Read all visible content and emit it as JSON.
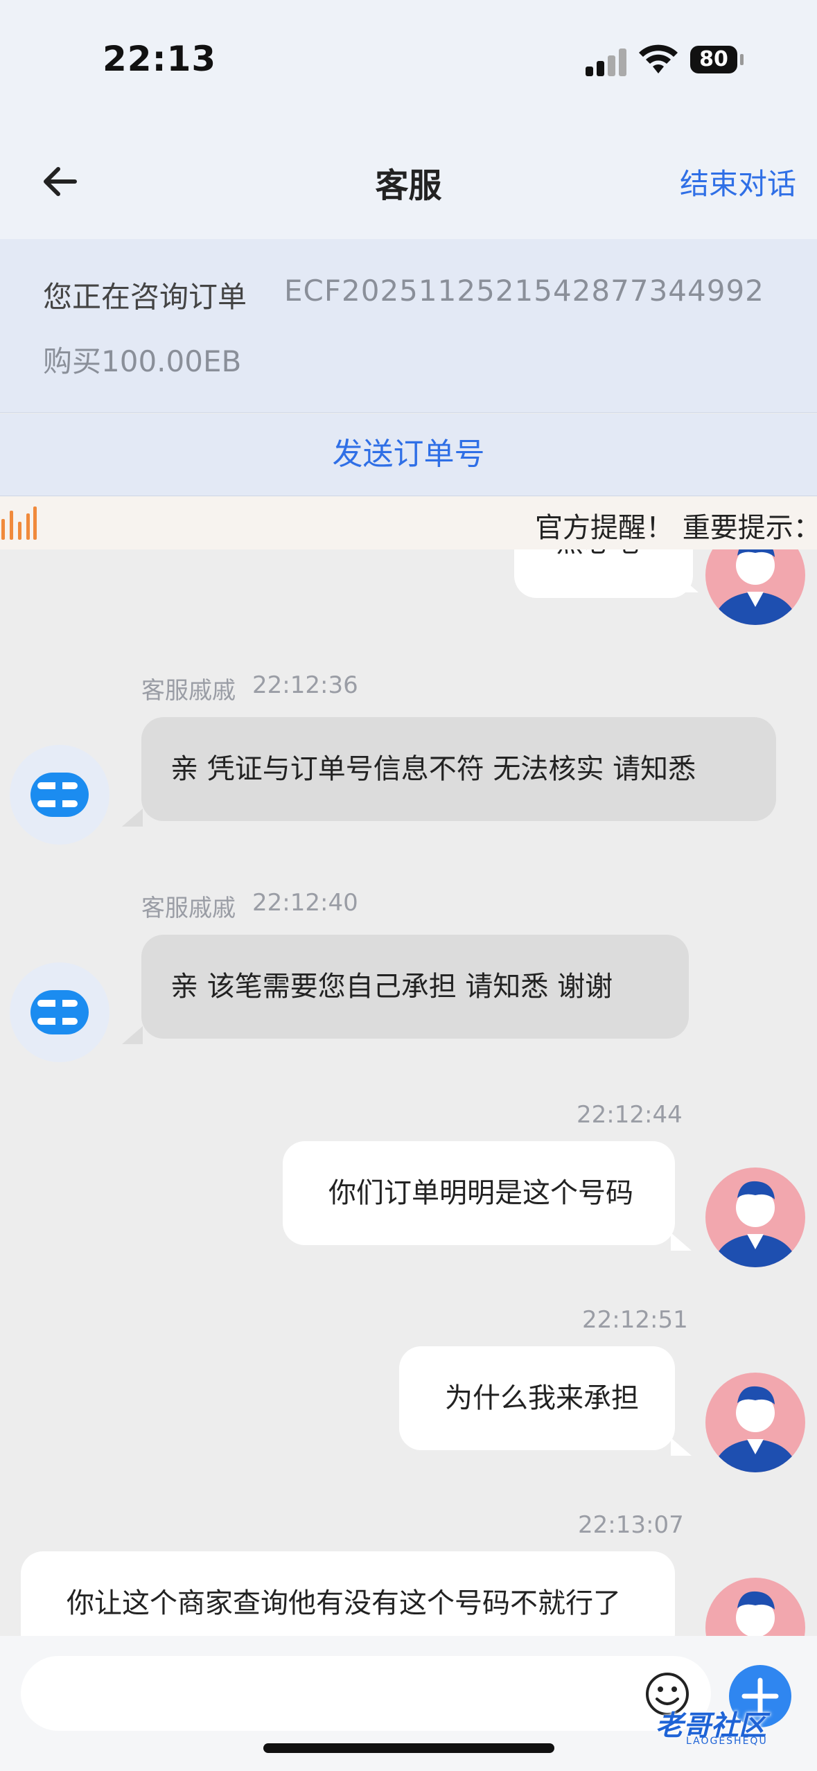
{
  "status_bar": {
    "time": "22:13",
    "battery": "80"
  },
  "nav": {
    "title": "客服",
    "end_chat": "结束对话"
  },
  "order": {
    "label": "您正在咨询订单",
    "number": "ECF20251125215428773449​92",
    "description": "购买100.00EB",
    "send_button": "发送订单号"
  },
  "notice": {
    "text": "官方提醒！ 重要提示："
  },
  "chat": {
    "messages": [
      {
        "side": "right",
        "time": "",
        "text": "黑心吧"
      },
      {
        "side": "left",
        "sender": "客服戚戚",
        "time": "22:12:36",
        "text": "亲 凭证与订单号信息不符 无法核实  请知悉"
      },
      {
        "side": "left",
        "sender": "客服戚戚",
        "time": "22:12:40",
        "text": "亲 该笔需要您自己承担 请知悉  谢谢"
      },
      {
        "side": "right",
        "time": "22:12:44",
        "text": "你们订单明明是这个号码"
      },
      {
        "side": "right",
        "time": "22:12:51",
        "text": "为什么我来承担"
      },
      {
        "side": "right",
        "time": "22:13:07",
        "text": "你让这个商家查询他有没有这个号码不就行了"
      }
    ]
  },
  "input": {
    "placeholder": ""
  },
  "watermark": {
    "text": "老哥社区",
    "sub": "LAOGESHEQU"
  },
  "colors": {
    "accent": "#2f6fe6",
    "plus_button": "#2f86f0",
    "avatar_user_bg": "#f2a7ae"
  }
}
